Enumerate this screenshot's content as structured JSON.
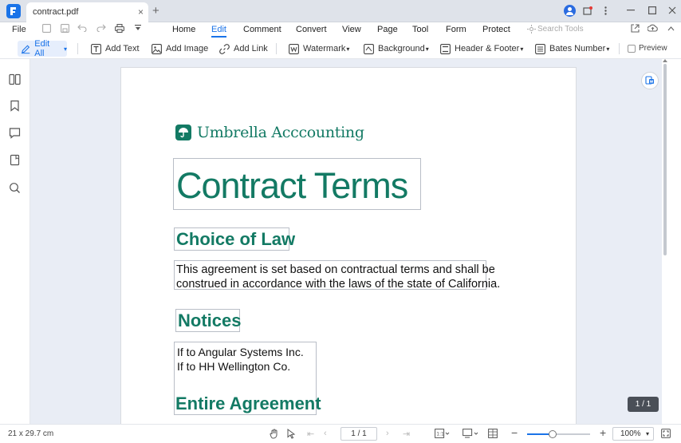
{
  "window": {
    "tab_title": "contract.pdf",
    "tab_close": "×",
    "tab_add": "+"
  },
  "menu": {
    "file": "File",
    "items": [
      "Home",
      "Edit",
      "Comment",
      "Convert",
      "View",
      "Page",
      "Tool",
      "Form",
      "Protect"
    ],
    "active": "Edit",
    "search_placeholder": "Search Tools"
  },
  "toolbar": {
    "edit_all": "Edit All",
    "add_text": "Add Text",
    "add_image": "Add Image",
    "add_link": "Add Link",
    "watermark": "Watermark",
    "background": "Background",
    "header_footer": "Header & Footer",
    "bates_number": "Bates Number",
    "preview": "Preview"
  },
  "document": {
    "brand_name": "Umbrella Acccounting",
    "title": "Contract Terms",
    "choice_heading": "Choice of Law",
    "choice_body": [
      "This agreement is set based on contractual terms and shall be",
      "construed in accordance with the laws of the state of California."
    ],
    "notices_heading": "Notices",
    "notices_body": [
      "If to Angular Systems Inc.",
      "If to HH Wellington Co."
    ],
    "entire_heading": "Entire Agreement"
  },
  "status": {
    "page_size": "21 x 29.7 cm",
    "page_field": "1 / 1",
    "page_badge": "1 / 1",
    "zoom": "100%",
    "zoom_level": 0.4
  },
  "colors": {
    "accent": "#1a73e8",
    "brand_green": "#137a64"
  }
}
